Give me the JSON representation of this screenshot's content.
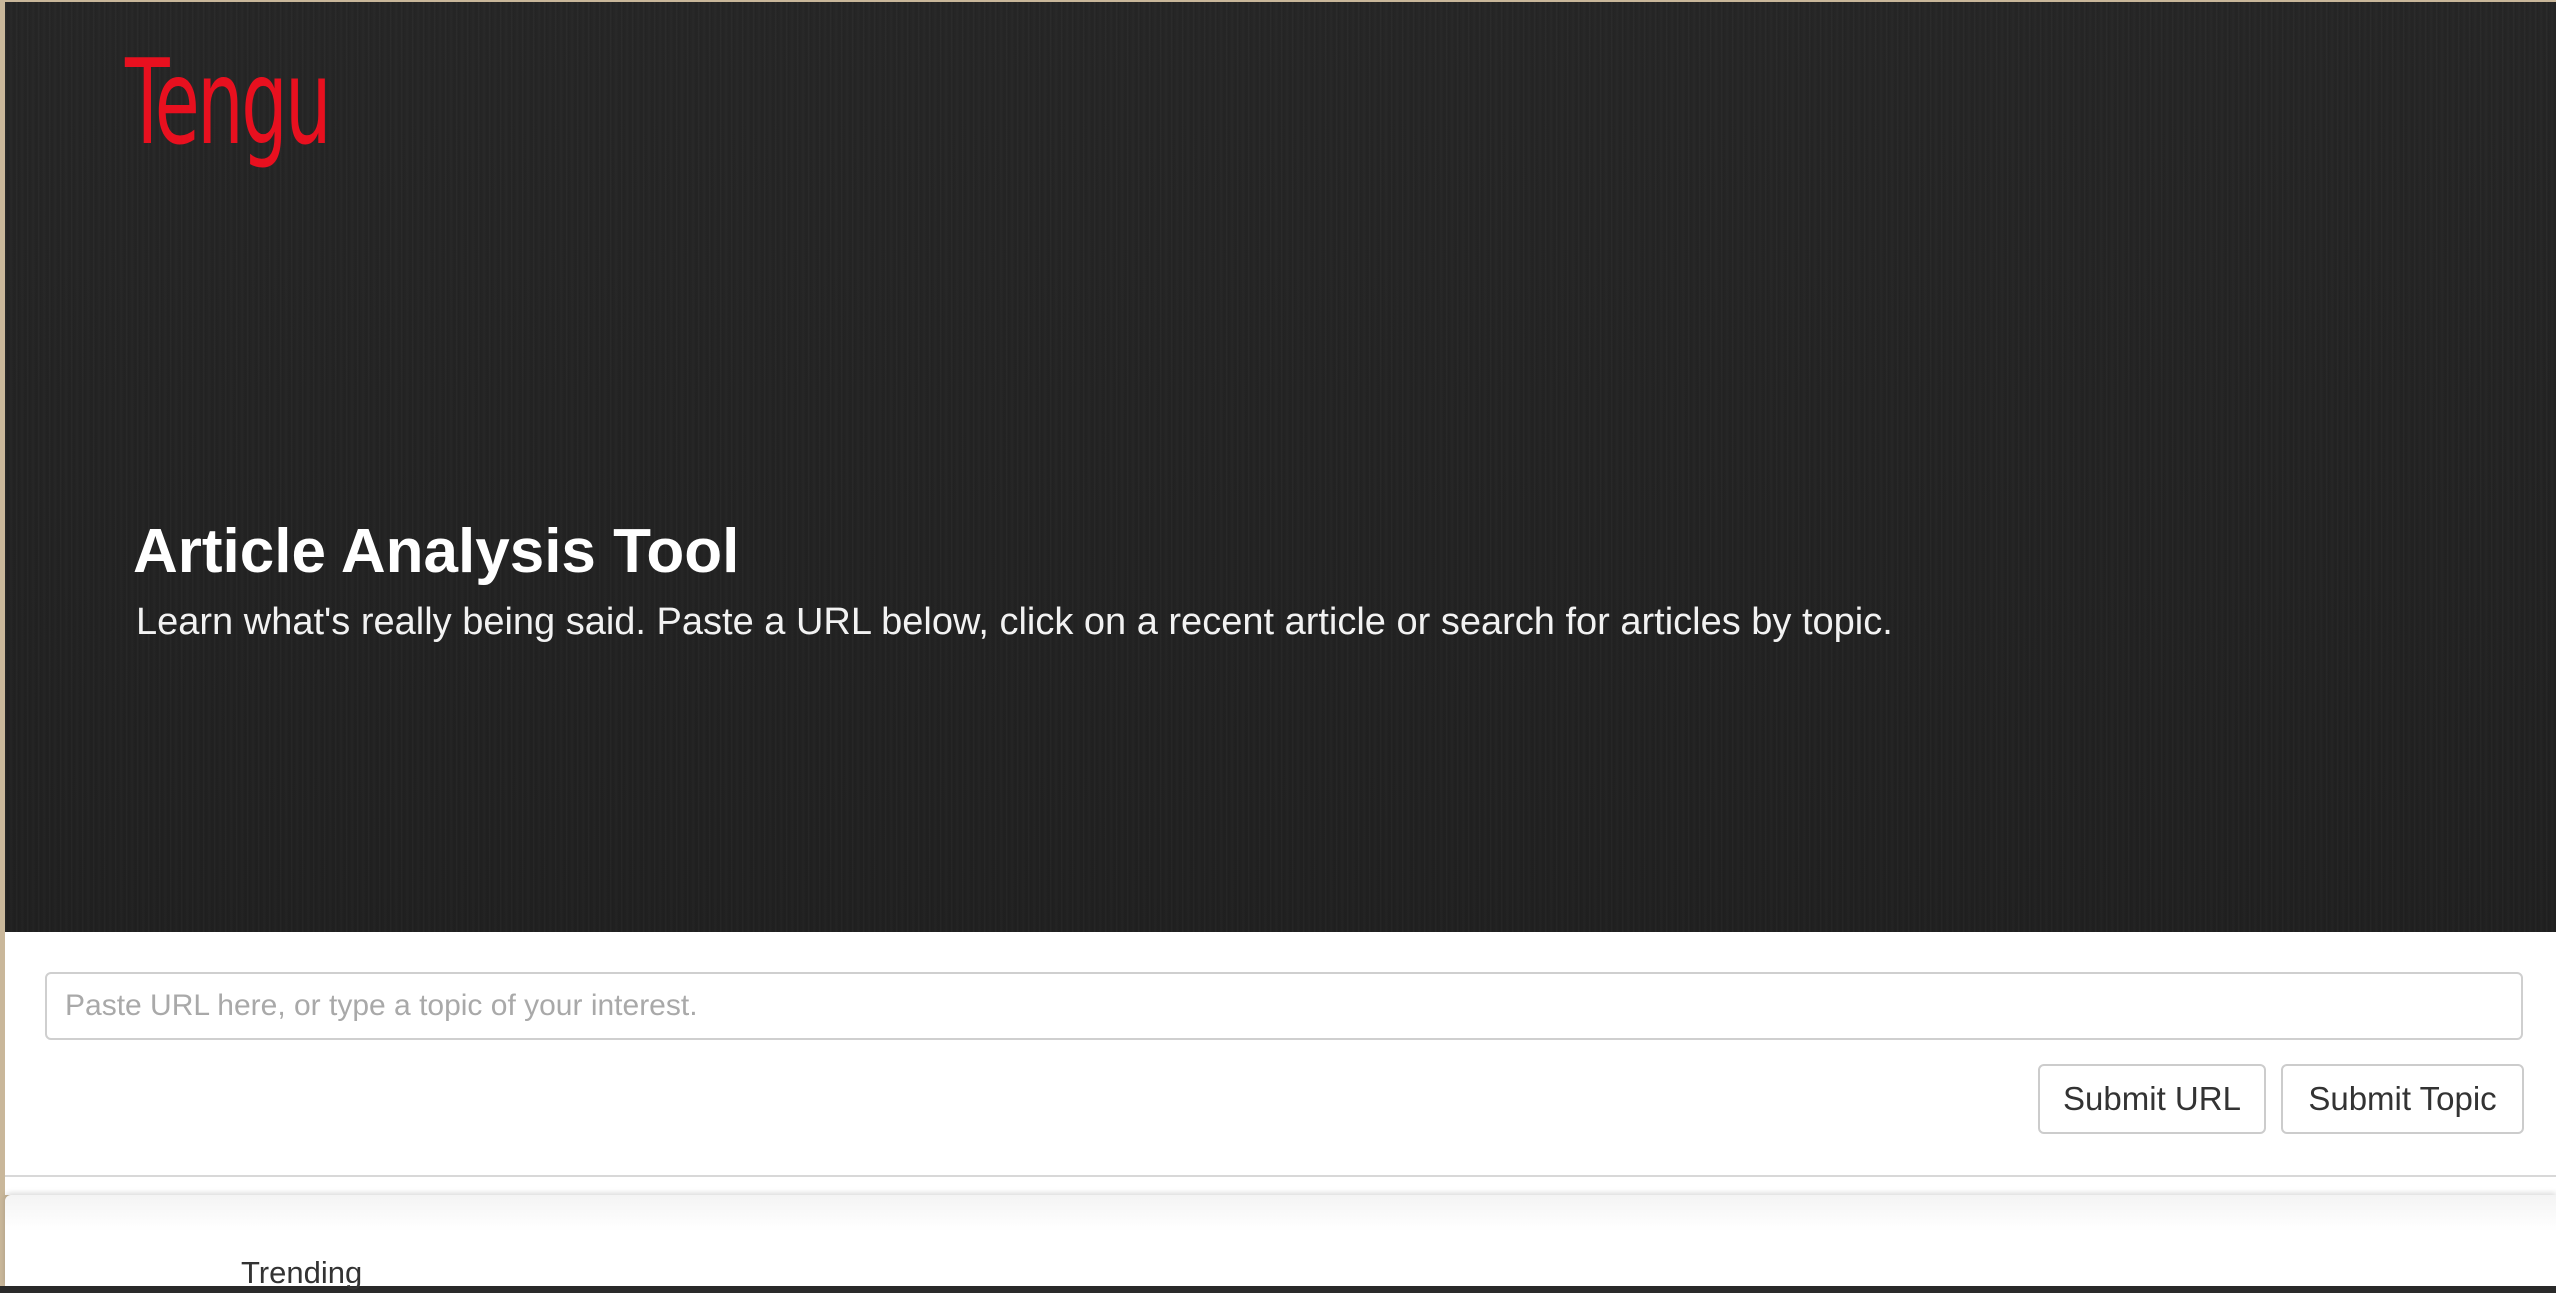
{
  "brand": {
    "logo_text": "Tengu",
    "accent_color": "#e8101f"
  },
  "hero": {
    "title": "Article Analysis Tool",
    "subtitle": "Learn what's really being said. Paste a URL below, click on a recent article or search for articles by topic."
  },
  "search": {
    "value": "",
    "placeholder": "Paste URL here, or type a topic of your interest.",
    "submit_url_label": "Submit URL",
    "submit_topic_label": "Submit Topic"
  },
  "trending": {
    "heading": "Trending"
  }
}
